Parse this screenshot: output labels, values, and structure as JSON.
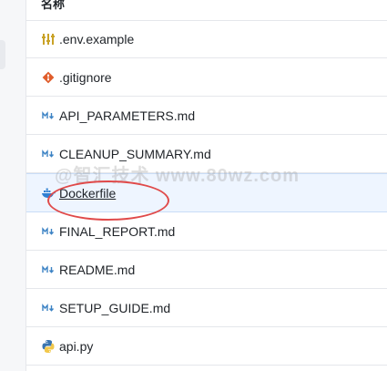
{
  "header": {
    "label": "名称"
  },
  "files": [
    {
      "name": ".env.example",
      "icon": "settings-file-icon"
    },
    {
      "name": ".gitignore",
      "icon": "git-icon"
    },
    {
      "name": "API_PARAMETERS.md",
      "icon": "markdown-icon"
    },
    {
      "name": "CLEANUP_SUMMARY.md",
      "icon": "markdown-icon"
    },
    {
      "name": "Dockerfile",
      "icon": "docker-icon",
      "selected": true
    },
    {
      "name": "FINAL_REPORT.md",
      "icon": "markdown-icon"
    },
    {
      "name": "README.md",
      "icon": "markdown-icon"
    },
    {
      "name": "SETUP_GUIDE.md",
      "icon": "markdown-icon"
    },
    {
      "name": "api.py",
      "icon": "python-icon"
    }
  ],
  "watermark": "@智汇技术 www.80wz.com",
  "colors": {
    "selected_row": "#eef5ff",
    "annotation": "#e04a4a",
    "markdown_icon": "#3b82c4",
    "git_icon": "#e05d2b",
    "docker_icon": "#2f7fd1",
    "python_blue": "#3a75b0",
    "python_yellow": "#f2c84b",
    "env_icon": "#c9a227"
  }
}
